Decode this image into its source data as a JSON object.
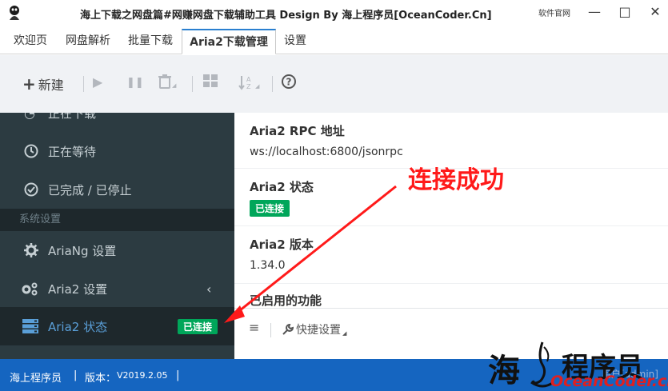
{
  "window": {
    "title": "海上下载之网盘篇#网赚网盘下载辅助工具 Design By 海上程序员[OceanCoder.Cn]",
    "soft_link": "软件官网",
    "min": "—",
    "max": "□",
    "close": "✕"
  },
  "tabs": [
    {
      "label": "欢迎页"
    },
    {
      "label": "网盘解析"
    },
    {
      "label": "批量下载"
    },
    {
      "label": "Aria2下载管理"
    },
    {
      "label": "设置"
    }
  ],
  "toolbar": {
    "new_label": "新建",
    "plus": "+",
    "play": "▶",
    "pause": "❚❚",
    "trash": "🗑",
    "grid": "▦",
    "sort": "⇅",
    "help": "?"
  },
  "sidebar": {
    "downloading": "正在下载",
    "waiting": "正在等待",
    "finished": "已完成 / 已停止",
    "section_settings": "系统设置",
    "ariang_settings": "AriaNg 设置",
    "aria2_settings": "Aria2 设置",
    "aria2_status": "Aria2 状态",
    "status_badge": "已连接",
    "caret": "‹"
  },
  "main": {
    "rpc_label": "Aria2 RPC 地址",
    "rpc_value": "ws://localhost:6800/jsonrpc",
    "status_label": "Aria2 状态",
    "status_value": "已连接",
    "version_label": "Aria2 版本",
    "version_value": "1.34.0",
    "features_label": "已启用的功能",
    "footer_menu": "≡",
    "footer_quick": "快捷设置"
  },
  "annotation": "连接成功",
  "statusbar": {
    "author": "海上程序员",
    "sep1": "|",
    "version_label": "版本：",
    "version": "V2019.2.05",
    "sep2": "|",
    "user": "用户[admin]"
  },
  "watermark": {
    "cn1": "海",
    "cn2": "程序员",
    "en": "OceanCoder.cn"
  },
  "colors": {
    "sidebar_bg": "#2c3b41",
    "sidebar_active": "#1e282c",
    "accent": "#5a9fd8",
    "badge_green": "#00a65a",
    "statusbar": "#1565c0",
    "annotation_red": "#ff1a1a"
  }
}
